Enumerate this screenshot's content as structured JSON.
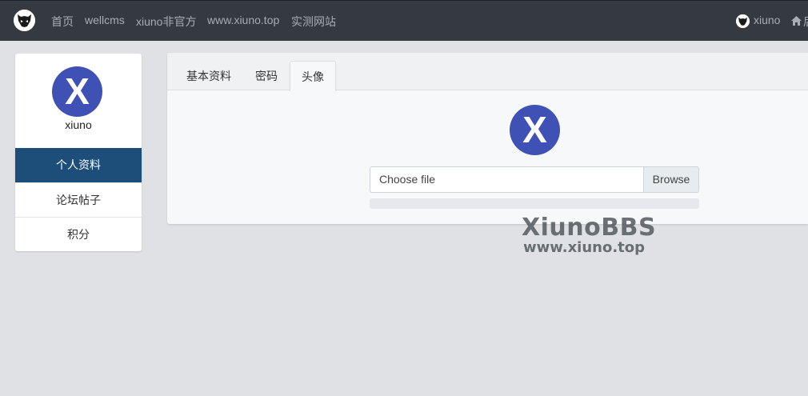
{
  "topbar": {
    "nav": [
      "首页",
      "wellcms",
      "xiuno非官方",
      "www.xiuno.top",
      "实测网站"
    ],
    "user_name": "xiuno",
    "home_label": "后"
  },
  "profile": {
    "avatar_letter": "X",
    "username": "xiuno",
    "menu": [
      "个人资料",
      "论坛帖子",
      "积分"
    ]
  },
  "tabs": [
    "基本资料",
    "密码",
    "头像"
  ],
  "avatar_upload": {
    "avatar_letter": "X",
    "file_label": "Choose file",
    "browse_label": "Browse",
    "progress": 0
  },
  "watermark": {
    "title": "XiunoBBS",
    "subtitle": "www.xiuno.top"
  },
  "colors": {
    "nav_bg": "#353a40",
    "avatar_bg": "#3f51b5",
    "active_menu": "#1d4e7a"
  }
}
